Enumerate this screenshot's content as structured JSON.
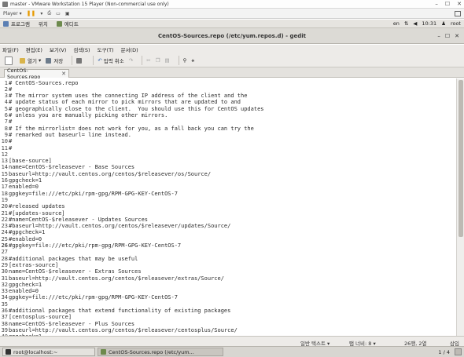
{
  "vmware": {
    "title": "master - VMware Workstation 15 Player (Non-commercial use only)",
    "player_label": "Player",
    "win_buttons": [
      "–",
      "☐",
      "✕"
    ]
  },
  "gnome_panel": {
    "menus": [
      "프로그램",
      "위치",
      "에디트"
    ],
    "lang": "en",
    "time": "10:31",
    "user": "root"
  },
  "gedit": {
    "window_title": "CentOS-Sources.repo (/etc/yum.repos.d) - gedit",
    "title_buttons": [
      "–",
      "☐",
      "✕"
    ],
    "menu": [
      "파일(F)",
      "편집(E)",
      "보기(V)",
      "검색(S)",
      "도구(T)",
      "문서(D)"
    ],
    "toolbar": {
      "open_label": "열기",
      "save_label": "저장",
      "undo_label": "입력 취소"
    },
    "tab_label": "CentOS-Sources.repo",
    "tab_close": "✕",
    "current_line": 26,
    "status": {
      "syntax": "일반 텍스트 ▾",
      "tab_width": "탭 너비: 8 ▾",
      "cursor": "26행, 2열",
      "mode": "삽입"
    }
  },
  "editor_lines": [
    "# CentOS-Sources.repo",
    "#",
    "# The mirror system uses the connecting IP address of the client and the",
    "# update status of each mirror to pick mirrors that are updated to and",
    "# geographically close to the client.  You should use this for CentOS updates",
    "# unless you are manually picking other mirrors.",
    "#",
    "# If the mirrorlist= does not work for you, as a fall back you can try the",
    "# remarked out baseurl= line instead.",
    "#",
    "#",
    "",
    "[base-source]",
    "name=CentOS-$releasever - Base Sources",
    "baseurl=http://vault.centos.org/centos/$releasever/os/Source/",
    "gpgcheck=1",
    "enabled=0",
    "gpgkey=file:///etc/pki/rpm-gpg/RPM-GPG-KEY-CentOS-7",
    "",
    "#released updates",
    "#[updates-source]",
    "#name=CentOS-$releasever - Updates Sources",
    "#baseurl=http://vault.centos.org/centos/$releasever/updates/Source/",
    "#gpgcheck=1",
    "#enabled=0",
    "#gpgkey=file:///etc/pki/rpm-gpg/RPM-GPG-KEY-CentOS-7",
    "",
    "#additional packages that may be useful",
    "[extras-source]",
    "name=CentOS-$releasever - Extras Sources",
    "baseurl=http://vault.centos.org/centos/$releasever/extras/Source/",
    "gpgcheck=1",
    "enabled=0",
    "gpgkey=file:///etc/pki/rpm-gpg/RPM-GPG-KEY-CentOS-7",
    "",
    "#additional packages that extend functionality of existing packages",
    "[centosplus-source]",
    "name=CentOS-$releasever - Plus Sources",
    "baseurl=http://vault.centos.org/centos/$releasever/centosplus/Source/",
    "gpgcheck=1"
  ],
  "taskbar": {
    "items": [
      "root@localhost:~",
      "CentOS-Sources.repo (/etc/yum..."
    ],
    "pager": "1 / 4"
  },
  "colors": {
    "accent_orange": "#e79a00",
    "panel": "#e6e4e0",
    "window_chrome": "#edebe8"
  }
}
